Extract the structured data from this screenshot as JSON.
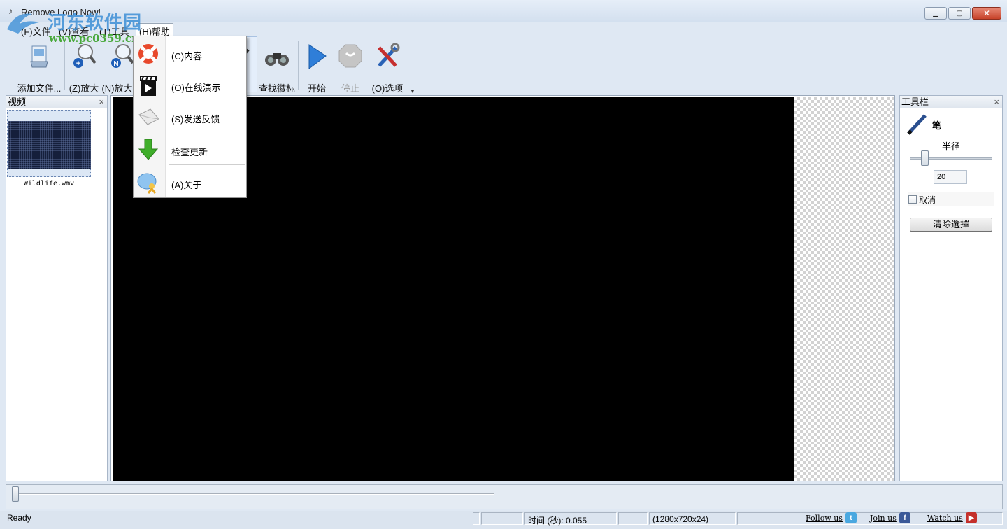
{
  "window": {
    "title": "Remove Logo Now!"
  },
  "watermark": {
    "site_name": "河东软件园",
    "url": "www.pc0359.cn"
  },
  "menubar": {
    "file": "(F)文件",
    "view": "(V)查看",
    "tools": "(T)工具",
    "help": "(H)帮助"
  },
  "toolbar": {
    "add_file": "添加文件...",
    "zoom_in": "(Z)放大",
    "zoom_normal": "(N)放大正",
    "find_logo": "查找徽标",
    "start": "开始",
    "stop": "停止",
    "options": "(O)选项"
  },
  "help_menu": {
    "contents": "(C)内容",
    "online_demo": "(O)在线演示",
    "feedback": "(S)发送反馈",
    "check_updates": "检查更新",
    "about": "(A)关于"
  },
  "video_panel": {
    "title": "视频",
    "close": "×",
    "file_name": "Wildlife.wmv"
  },
  "tool_panel": {
    "title": "工具栏",
    "close": "×",
    "pen_label": "笔",
    "radius_label": "半径",
    "radius_value": "20",
    "cancel_label": "取消",
    "clear_button": "清除選擇"
  },
  "statusbar": {
    "status": "Ready",
    "time": "时间 (秒): 0.055",
    "resolution": "(1280x720x24)",
    "follow_us": "Follow us",
    "join_us": "Join us",
    "watch_us": "Watch us"
  },
  "colors": {
    "twitter": "#4aa8e0",
    "facebook": "#3b5998",
    "youtube": "#c4302b",
    "start_blue": "#2f7ed8"
  }
}
